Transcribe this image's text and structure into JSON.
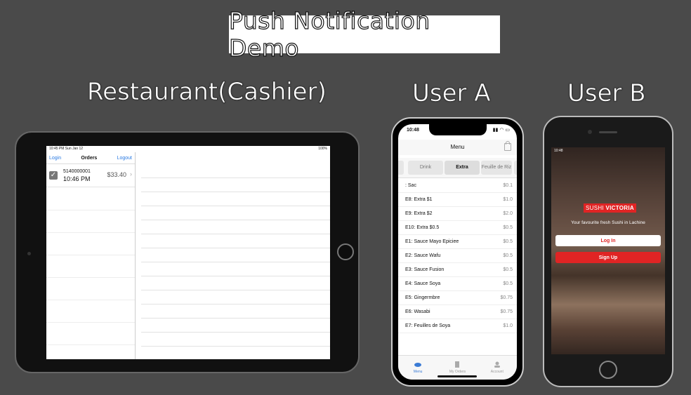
{
  "title": "Push Notification Demo",
  "headings": {
    "restaurant": "Restaurant(Cashier)",
    "user_a": "User A",
    "user_b": "User B"
  },
  "ipad": {
    "status_time": "10:45 PM  Sun Jan 12",
    "status_right": "100%",
    "nav": {
      "login": "Login",
      "title": "Orders",
      "logout": "Logout"
    },
    "order": {
      "id": "5140000001",
      "time": "10:46 PM",
      "amount": "$33.40"
    }
  },
  "user_a": {
    "status_time": "10:48",
    "nav_title": "Menu",
    "categories": [
      "Drink",
      "Extra",
      "Feuille de Riz"
    ],
    "items": [
      {
        "name": ": Sac",
        "price": "$0.1"
      },
      {
        "name": "E8: Extra $1",
        "price": "$1.0"
      },
      {
        "name": "E9: Extra $2",
        "price": "$2.0"
      },
      {
        "name": "E10: Extra $0.5",
        "price": "$0.5"
      },
      {
        "name": "E1: Sauce Mayo Epiciee",
        "price": "$0.5"
      },
      {
        "name": "E2: Sauce Wafu",
        "price": "$0.5"
      },
      {
        "name": "E3: Sauce Fusion",
        "price": "$0.5"
      },
      {
        "name": "E4: Sauce Soya",
        "price": "$0.5"
      },
      {
        "name": "E5: Gingermbre",
        "price": "$0.75"
      },
      {
        "name": "E6: Wasabi",
        "price": "$0.75"
      },
      {
        "name": "E7: Feuilles de Soya",
        "price": "$1.0"
      }
    ],
    "tabs": [
      "Menu",
      "My Orders",
      "Account"
    ]
  },
  "user_b": {
    "status": "10:48",
    "brand_part1": "SUSHI",
    "brand_part2": "VICTORIA",
    "tagline": "Your favourite fresh Sushi in Lachine",
    "login_label": "Log In",
    "signup_label": "Sign Up"
  },
  "colors": {
    "background": "#4a4a4a",
    "accent_red": "#e02424",
    "link_blue": "#2a7ae2"
  }
}
